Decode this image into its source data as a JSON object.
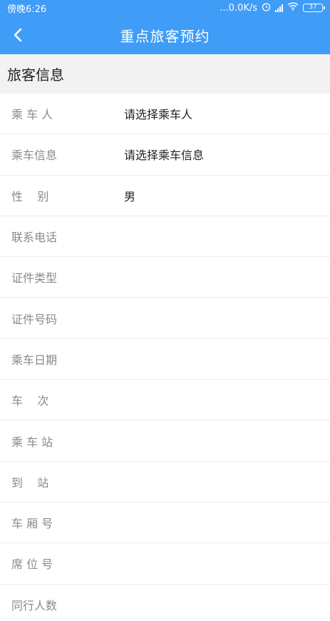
{
  "status_bar": {
    "time": "傍晚6:26",
    "network_speed": "...0.0K/s",
    "battery": "37"
  },
  "header": {
    "back_icon": "chevron-left-icon",
    "title": "重点旅客预约"
  },
  "section": {
    "title": "旅客信息"
  },
  "fields": [
    {
      "label": "乘 车 人",
      "value": "请选择乘车人"
    },
    {
      "label": "乘车信息",
      "value": "请选择乘车信息"
    },
    {
      "label": "性    别",
      "value": "男"
    },
    {
      "label": "联系电话",
      "value": ""
    },
    {
      "label": "证件类型",
      "value": ""
    },
    {
      "label": "证件号码",
      "value": ""
    },
    {
      "label": "乘车日期",
      "value": ""
    },
    {
      "label": "车    次",
      "value": ""
    },
    {
      "label": "乘 车 站",
      "value": ""
    },
    {
      "label": "到    站",
      "value": ""
    },
    {
      "label": "车 厢 号",
      "value": ""
    },
    {
      "label": "席 位 号",
      "value": ""
    },
    {
      "label": "同行人数",
      "value": ""
    }
  ],
  "colors": {
    "accent": "#3f9cf7",
    "label": "#8a8a8a",
    "section_bg": "#f2f2f2"
  }
}
